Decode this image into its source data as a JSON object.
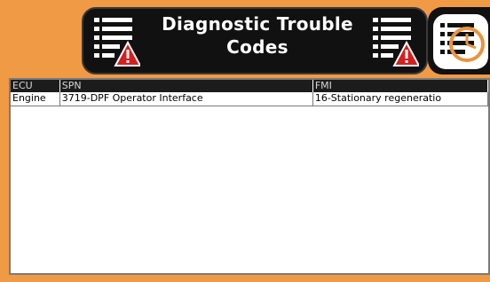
{
  "header": {
    "title_line1": "Diagnostic Trouble",
    "title_line2": "Codes"
  },
  "icons": {
    "left": "dtc-list-warning-icon",
    "right": "dtc-list-warning-icon",
    "history": "history-clock-icon"
  },
  "colors": {
    "frame": "#f19a46",
    "header_bg": "#111111",
    "warning": "#d42020"
  },
  "table": {
    "columns": [
      "ECU",
      "SPN",
      "FMI"
    ],
    "rows": [
      {
        "ecu": "Engine",
        "spn": "3719-DPF Operator Interface",
        "fmi": "16-Stationary regeneratio"
      }
    ]
  }
}
